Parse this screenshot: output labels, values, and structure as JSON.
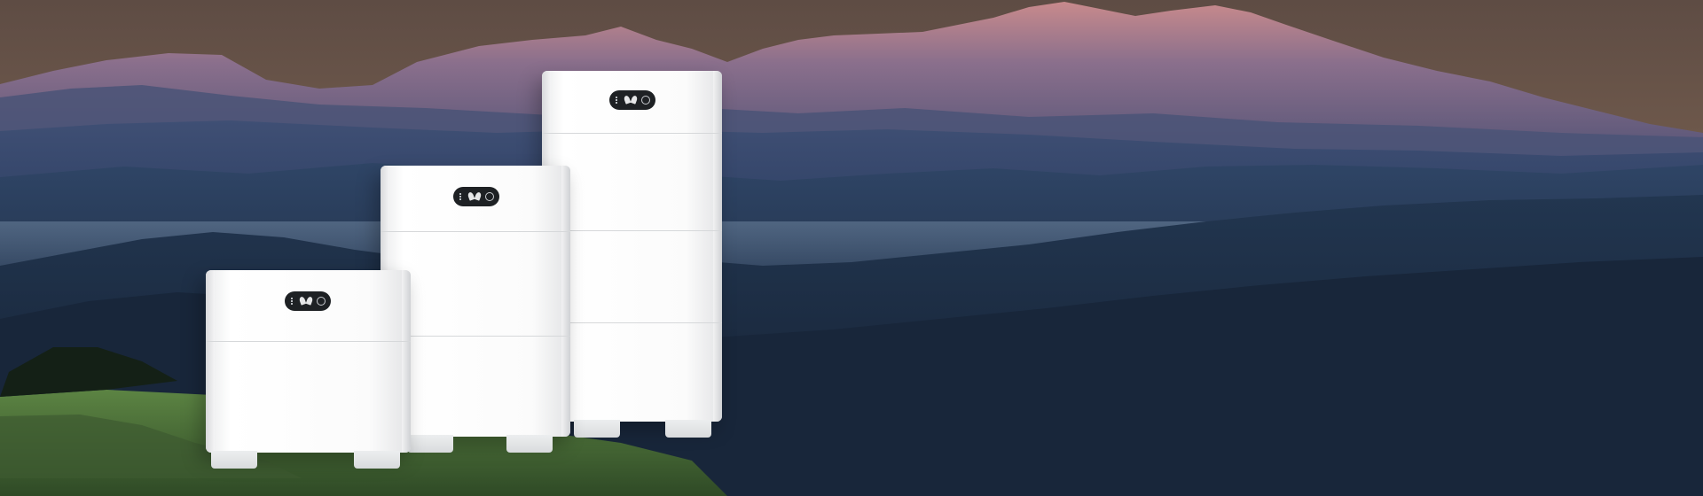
{
  "scene": {
    "sky_top": "#6b5a4e",
    "sky_mid": "#8a6a55",
    "peak_glow": "#c98a8a",
    "mountain_far": "#5e5a7c",
    "ridge_blue": "#2f4466",
    "forest_dark": "#1d2a3e",
    "meadow_green": "#4f7a3a"
  },
  "products": [
    {
      "name": "battery-stack-small",
      "modules": 1,
      "brand_panel": "panel-small"
    },
    {
      "name": "battery-stack-medium",
      "modules": 2,
      "brand_panel": "panel-medium"
    },
    {
      "name": "battery-stack-large",
      "modules": 3,
      "brand_panel": "panel-large"
    }
  ]
}
